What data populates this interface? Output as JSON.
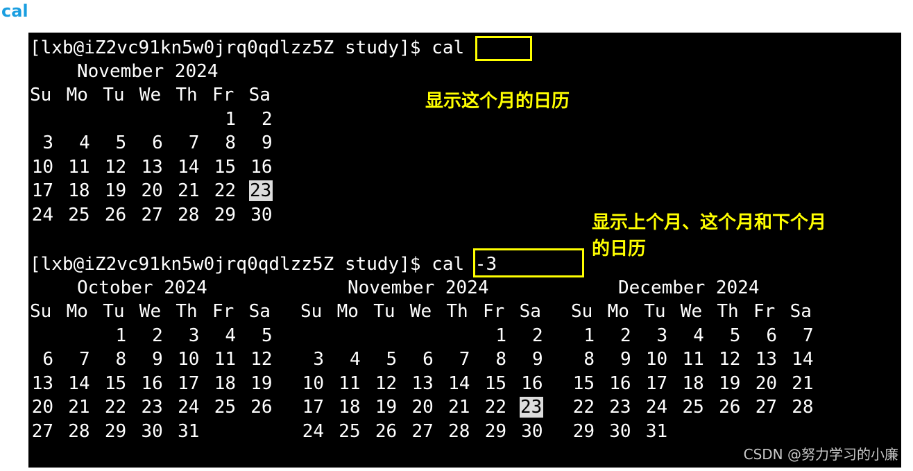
{
  "heading": "cal",
  "terminal": {
    "prompt": "[lxb@iZ2vc91kn5w0jrq0qdlzz5Z study]$ ",
    "cmd1": "cal",
    "cmd2": "cal -3",
    "month_current": "November 2024",
    "month_prev": "October 2024",
    "month_next": "December 2024",
    "weekdays": [
      "Su",
      "Mo",
      "Tu",
      "We",
      "Th",
      "Fr",
      "Sa"
    ],
    "today": "23",
    "cal_nov": [
      [
        "",
        "",
        "",
        "",
        "",
        "1",
        "2"
      ],
      [
        "3",
        "4",
        "5",
        "6",
        "7",
        "8",
        "9"
      ],
      [
        "10",
        "11",
        "12",
        "13",
        "14",
        "15",
        "16"
      ],
      [
        "17",
        "18",
        "19",
        "20",
        "21",
        "22",
        "23"
      ],
      [
        "24",
        "25",
        "26",
        "27",
        "28",
        "29",
        "30"
      ]
    ],
    "cal_oct": [
      [
        "",
        "",
        "1",
        "2",
        "3",
        "4",
        "5"
      ],
      [
        "6",
        "7",
        "8",
        "9",
        "10",
        "11",
        "12"
      ],
      [
        "13",
        "14",
        "15",
        "16",
        "17",
        "18",
        "19"
      ],
      [
        "20",
        "21",
        "22",
        "23",
        "24",
        "25",
        "26"
      ],
      [
        "27",
        "28",
        "29",
        "30",
        "31",
        "",
        ""
      ]
    ],
    "cal_dec": [
      [
        "1",
        "2",
        "3",
        "4",
        "5",
        "6",
        "7"
      ],
      [
        "8",
        "9",
        "10",
        "11",
        "12",
        "13",
        "14"
      ],
      [
        "15",
        "16",
        "17",
        "18",
        "19",
        "20",
        "21"
      ],
      [
        "22",
        "23",
        "24",
        "25",
        "26",
        "27",
        "28"
      ],
      [
        "29",
        "30",
        "31",
        "",
        "",
        "",
        ""
      ]
    ]
  },
  "annotations": {
    "note1": "显示这个月的日历",
    "note2_line1": "显示上个月、这个月和下个月",
    "note2_line2": "的日历"
  },
  "colors": {
    "heading": "#1a9ee0",
    "terminal_bg": "#000000",
    "terminal_fg": "#ffffff",
    "highlight": "#ffff00",
    "today_bg": "#dcdcdc"
  },
  "watermark": "CSDN @努力学习的小廉"
}
